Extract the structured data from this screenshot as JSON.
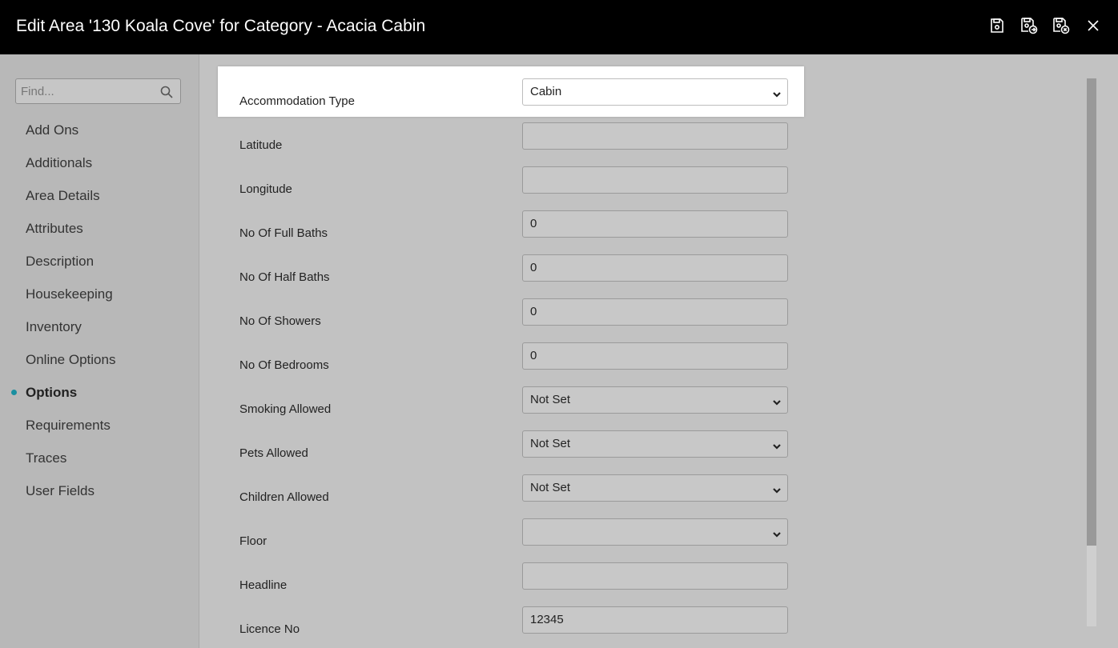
{
  "window": {
    "title": "Edit Area '130 Koala Cove' for Category - Acacia Cabin",
    "actions": [
      {
        "name": "save-icon"
      },
      {
        "name": "save-and-forward-icon"
      },
      {
        "name": "save-and-close-icon"
      },
      {
        "name": "close-icon"
      }
    ]
  },
  "sidebar": {
    "search_placeholder": "Find...",
    "items": [
      {
        "label": "Add Ons"
      },
      {
        "label": "Additionals"
      },
      {
        "label": "Area Details"
      },
      {
        "label": "Attributes"
      },
      {
        "label": "Description"
      },
      {
        "label": "Housekeeping"
      },
      {
        "label": "Inventory"
      },
      {
        "label": "Online Options"
      },
      {
        "label": "Options",
        "active": true
      },
      {
        "label": "Requirements"
      },
      {
        "label": "Traces"
      },
      {
        "label": "User Fields"
      }
    ]
  },
  "form": {
    "fields": [
      {
        "label": "Accommodation Type",
        "type": "select",
        "value": "Cabin"
      },
      {
        "label": "Latitude",
        "type": "text",
        "value": ""
      },
      {
        "label": "Longitude",
        "type": "text",
        "value": ""
      },
      {
        "label": "No Of Full Baths",
        "type": "text",
        "value": "0"
      },
      {
        "label": "No Of Half Baths",
        "type": "text",
        "value": "0"
      },
      {
        "label": "No Of Showers",
        "type": "text",
        "value": "0"
      },
      {
        "label": "No Of Bedrooms",
        "type": "text",
        "value": "0"
      },
      {
        "label": "Smoking Allowed",
        "type": "select",
        "value": "Not Set"
      },
      {
        "label": "Pets Allowed",
        "type": "select",
        "value": "Not Set"
      },
      {
        "label": "Children Allowed",
        "type": "select",
        "value": "Not Set"
      },
      {
        "label": "Floor",
        "type": "select",
        "value": ""
      },
      {
        "label": "Headline",
        "type": "text",
        "value": ""
      },
      {
        "label": "Licence No",
        "type": "text",
        "value": "12345"
      }
    ]
  },
  "colors": {
    "titlebar": "#000000",
    "active_dot": "#1a8fa0",
    "overlay": "#c2c2c2"
  }
}
